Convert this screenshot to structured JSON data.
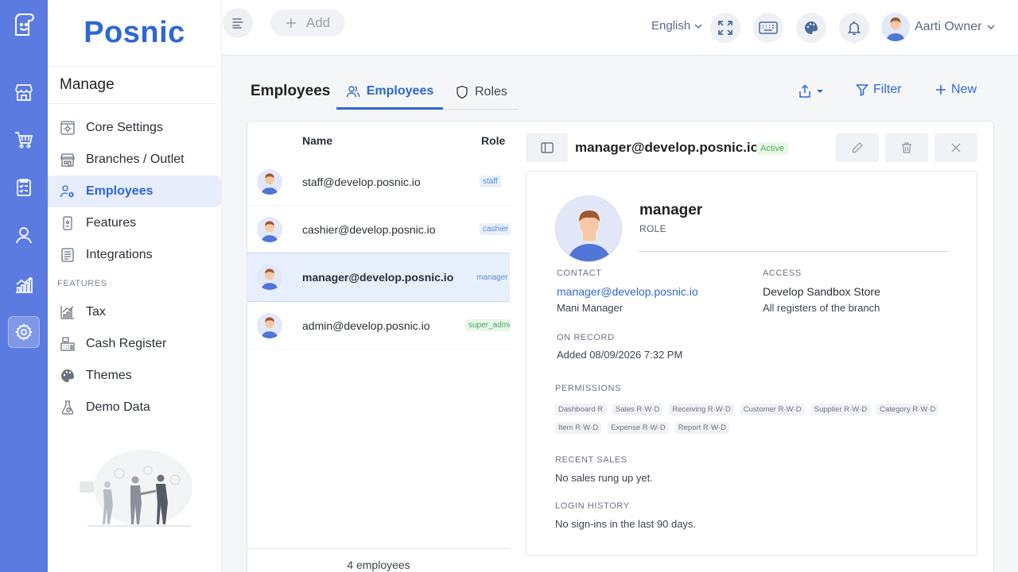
{
  "app": {
    "brand": "Posnic"
  },
  "sidebar": {
    "heading": "Manage",
    "items": [
      {
        "label": "Core Settings",
        "icon": "core-settings-icon"
      },
      {
        "label": "Branches / Outlet",
        "icon": "branches-icon"
      },
      {
        "label": "Employees",
        "icon": "employees-icon",
        "active": true
      },
      {
        "label": "Features",
        "icon": "features-icon"
      },
      {
        "label": "Integrations",
        "icon": "integrations-icon"
      }
    ],
    "section_label": "FEATURES",
    "feature_items": [
      {
        "label": "Tax",
        "icon": "tax-icon"
      },
      {
        "label": "Cash Register",
        "icon": "cash-register-icon"
      },
      {
        "label": "Themes",
        "icon": "palette-icon"
      },
      {
        "label": "Demo Data",
        "icon": "demo-data-icon"
      }
    ]
  },
  "topbar": {
    "add_label": "Add",
    "language": "English",
    "user_name": "Aarti Owner"
  },
  "page": {
    "title": "Employees",
    "tabs": [
      {
        "label": "Employees",
        "active": true
      },
      {
        "label": "Roles",
        "active": false
      }
    ],
    "filter_label": "Filter",
    "new_label": "New"
  },
  "list": {
    "columns": [
      "Name",
      "Role"
    ],
    "rows": [
      {
        "email": "staff@develop.posnic.io",
        "role": "staff"
      },
      {
        "email": "cashier@develop.posnic.io",
        "role": "cashier"
      },
      {
        "email": "manager@develop.posnic.io",
        "role": "manager",
        "selected": true
      },
      {
        "email": "admin@develop.posnic.io",
        "role": "super_admin"
      }
    ],
    "footer": "4 employees"
  },
  "detail": {
    "email": "manager@develop.posnic.io",
    "status": "Active",
    "name": "manager",
    "role_label": "ROLE",
    "contact_label": "CONTACT",
    "contact_email": "manager@develop.posnic.io",
    "contact_name": "Mani Manager",
    "access_label": "ACCESS",
    "access_store": "Develop Sandbox Store",
    "access_scope": "All registers of the branch",
    "record_label": "ON RECORD",
    "record_value": "Added 08/09/2026 7:32 PM",
    "permissions_label": "PERMISSIONS",
    "permissions": [
      "Dashboard R",
      "Sales R·W·D",
      "Receiving R·W·D",
      "Customer R·W·D",
      "Supplier R·W·D",
      "Category R·W·D",
      "Item R·W·D",
      "Expense R·W·D",
      "Report R·W·D"
    ],
    "recent_sales_label": "RECENT SALES",
    "recent_sales_value": "No sales rung up yet.",
    "login_label": "LOGIN HISTORY",
    "login_value": "No sign-ins in the last 90 days."
  },
  "colors": {
    "accent": "#2f67d1",
    "rail": "#5b7be0",
    "active_green": "#4caf50"
  }
}
